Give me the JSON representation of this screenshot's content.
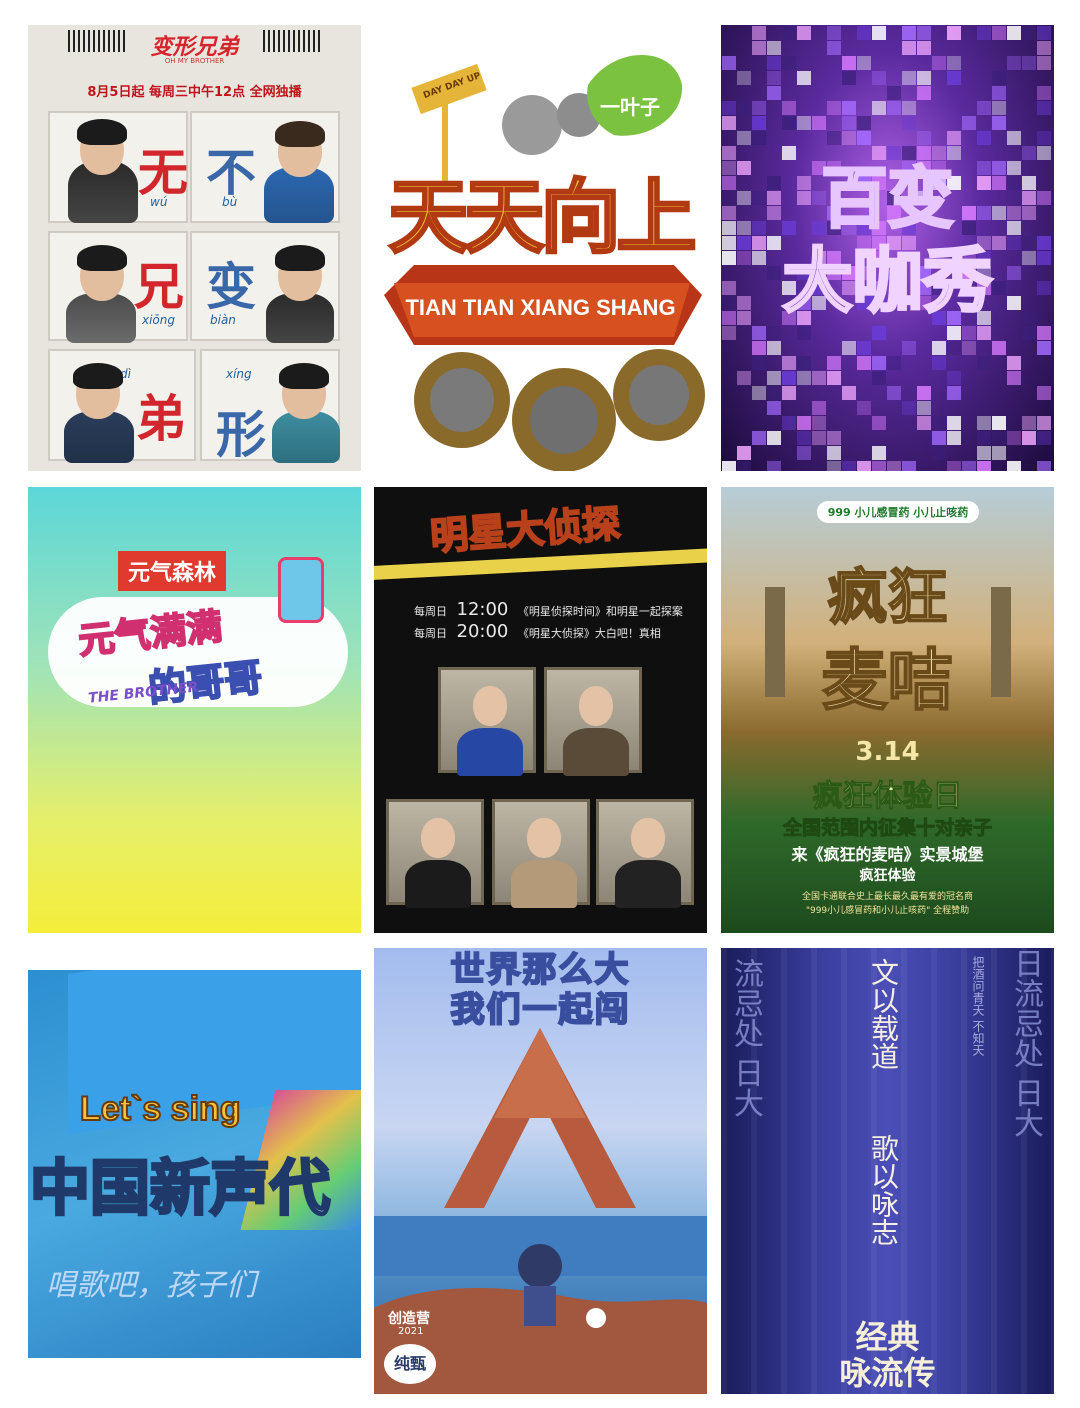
{
  "tiles": {
    "t1": {
      "title": "变形兄弟",
      "subtitle": "OH MY BROTHER",
      "schedule": "8月5日起 每周三中午12点 全网独播",
      "panels": [
        {
          "char": "无",
          "pinyin": "wú"
        },
        {
          "char": "不",
          "pinyin": "bù"
        },
        {
          "char": "兄",
          "pinyin": "xiōng"
        },
        {
          "char": "变",
          "pinyin": "biàn"
        },
        {
          "char": "弟",
          "pinyin": "dì"
        },
        {
          "char": "形",
          "pinyin": "xíng"
        }
      ]
    },
    "t2": {
      "title": "天天向上",
      "english": "TIAN TIAN XIANG SHANG",
      "leaf": "一叶子",
      "sign": "DAY DAY UP"
    },
    "t3": {
      "title_line1": "百变",
      "title_line2": "大咖秀"
    },
    "t4": {
      "sponsor": "元气森林",
      "title_line1": "元气满满",
      "title_line2": "的哥哥",
      "english": "THE BROTHER"
    },
    "t5": {
      "title": "明星大侦探",
      "schedule": [
        {
          "day": "每周日",
          "time": "12:00",
          "desc": "《明星侦探时间》和明星一起探案"
        },
        {
          "day": "每周日",
          "time": "20:00",
          "desc": "《明星大侦探》大白吧！真相"
        }
      ]
    },
    "t6": {
      "sponsor": "999 小儿感冒药 小儿止咳药",
      "title_line1": "疯狂",
      "title_line2": "麦咭",
      "date": "3.14",
      "line1": "疯狂体验日",
      "line2": "全国范围内征集十对亲子",
      "line3": "来《疯狂的麦咭》实景城堡",
      "line4": "疯狂体验",
      "line5": "全国卡通联合史上最长最久最有爱的冠名商",
      "line6": "\"999小儿感冒药和小儿止咳药\" 全程赞助"
    },
    "t7": {
      "tag": "Let`s sing",
      "title": "中国新声代",
      "slogan": "唱歌吧，孩子们"
    },
    "t8": {
      "line1": "世界那么大",
      "line2": "我们一起闯",
      "brand": "创造营",
      "year": "2021",
      "badge": "纯甄"
    },
    "t9": {
      "line1": "文以载道",
      "line2": "歌以咏志",
      "title_line1": "经典",
      "title_line2": "咏流传",
      "side_left": "流忌处 日大",
      "side_right": "日流忌处 日大",
      "side_mid": "把酒问青天 不知天"
    }
  }
}
